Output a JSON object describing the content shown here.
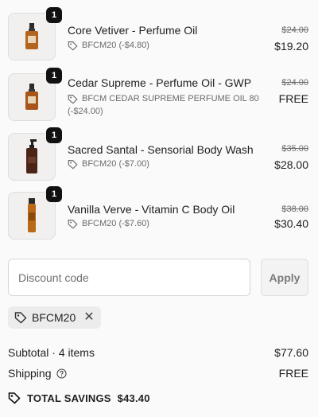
{
  "items": [
    {
      "qty": "1",
      "title": "Core Vetiver - Perfume Oil",
      "discount": "BFCM20 (-$4.80)",
      "original_price": "$24.00",
      "price": "$19.20",
      "image_icon": "perfume-bottle-icon"
    },
    {
      "qty": "1",
      "title": "Cedar Supreme - Perfume Oil - GWP",
      "discount_line1": "BFCM CEDAR SUPREME PERFUME OIL 80",
      "discount_line2": "(-$24.00)",
      "original_price": "$24.00",
      "price": "FREE",
      "image_icon": "perfume-bottle-icon"
    },
    {
      "qty": "1",
      "title": "Sacred Santal - Sensorial Body Wash",
      "discount": "BFCM20 (-$7.00)",
      "original_price": "$35.00",
      "price": "$28.00",
      "image_icon": "body-wash-bottle-icon"
    },
    {
      "qty": "1",
      "title": "Vanilla Verve - Vitamin C Body Oil",
      "discount": "BFCM20 (-$7.60)",
      "original_price": "$38.00",
      "price": "$30.40",
      "image_icon": "body-oil-bottle-icon"
    }
  ],
  "discount": {
    "placeholder": "Discount code",
    "apply_label": "Apply",
    "applied_code": "BFCM20"
  },
  "summary": {
    "subtotal_label": "Subtotal · 4 items",
    "subtotal_value": "$77.60",
    "shipping_label": "Shipping",
    "shipping_value": "FREE",
    "savings_label": "TOTAL SAVINGS",
    "savings_value": "$43.40"
  },
  "colors": {
    "badge": "#111111",
    "background": "#fafafa",
    "bottle_amber": "#b3641f",
    "bottle_dark": "#4a2418"
  }
}
